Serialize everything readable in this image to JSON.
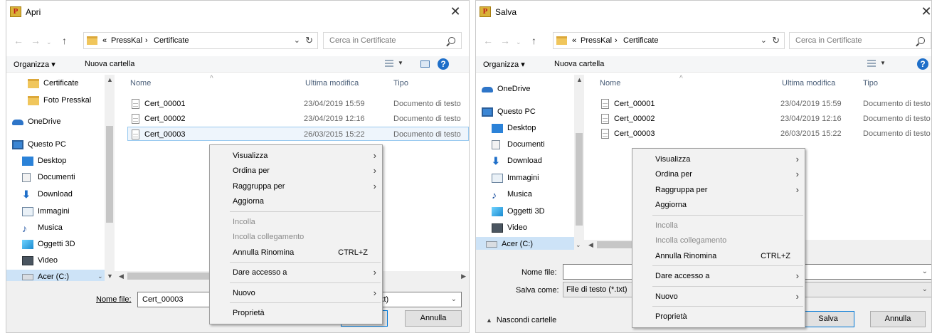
{
  "dialogs": [
    {
      "title": "Apri",
      "app_icon": "presskal-icon",
      "address": {
        "prefix": "«",
        "path": [
          "PressKal",
          "Certificate"
        ],
        "separator": "›"
      },
      "search_placeholder": "Cerca in Certificate",
      "toolbar": {
        "organize": "Organizza ▾",
        "new_folder": "Nuova cartella"
      },
      "nav_items": [
        {
          "label": "Certificate",
          "icon": "folder-icon"
        },
        {
          "label": "Foto Presskal",
          "icon": "folder-icon"
        },
        {
          "label": "OneDrive",
          "icon": "onedrive-icon"
        },
        {
          "label": "Questo PC",
          "icon": "computer-icon"
        },
        {
          "label": "Desktop",
          "icon": "desktop-icon"
        },
        {
          "label": "Documenti",
          "icon": "documents-icon"
        },
        {
          "label": "Download",
          "icon": "download-icon"
        },
        {
          "label": "Immagini",
          "icon": "images-icon"
        },
        {
          "label": "Musica",
          "icon": "music-icon"
        },
        {
          "label": "Oggetti 3D",
          "icon": "3d-objects-icon"
        },
        {
          "label": "Video",
          "icon": "video-icon"
        },
        {
          "label": "Acer (C:)",
          "icon": "drive-icon"
        }
      ],
      "columns": [
        "Nome",
        "Ultima modifica",
        "Tipo"
      ],
      "files": [
        {
          "name": "Cert_00001",
          "modified": "23/04/2019 15:59",
          "type": "Documento di testo"
        },
        {
          "name": "Cert_00002",
          "modified": "23/04/2019 12:16",
          "type": "Documento di testo"
        },
        {
          "name": "Cert_00003",
          "modified": "26/03/2015 15:22",
          "type": "Documento di testo"
        }
      ],
      "selected_file": "Cert_00003",
      "bottom": {
        "filename_label": "Nome file:",
        "filename_value": "Cert_00003",
        "filter_visible": "xt)",
        "cancel": "Annulla"
      }
    },
    {
      "title": "Salva",
      "app_icon": "presskal-icon",
      "address": {
        "prefix": "«",
        "path": [
          "PressKal",
          "Certificate"
        ],
        "separator": "›"
      },
      "search_placeholder": "Cerca in Certificate",
      "toolbar": {
        "organize": "Organizza ▾",
        "new_folder": "Nuova cartella"
      },
      "nav_items": [
        {
          "label": "OneDrive",
          "icon": "onedrive-icon"
        },
        {
          "label": "Questo PC",
          "icon": "computer-icon"
        },
        {
          "label": "Desktop",
          "icon": "desktop-icon"
        },
        {
          "label": "Documenti",
          "icon": "documents-icon"
        },
        {
          "label": "Download",
          "icon": "download-icon"
        },
        {
          "label": "Immagini",
          "icon": "images-icon"
        },
        {
          "label": "Musica",
          "icon": "music-icon"
        },
        {
          "label": "Oggetti 3D",
          "icon": "3d-objects-icon"
        },
        {
          "label": "Video",
          "icon": "video-icon"
        },
        {
          "label": "Acer (C:)",
          "icon": "drive-icon"
        }
      ],
      "columns": [
        "Nome",
        "Ultima modifica",
        "Tipo"
      ],
      "files": [
        {
          "name": "Cert_00001",
          "modified": "23/04/2019 15:59",
          "type": "Documento di testo"
        },
        {
          "name": "Cert_00002",
          "modified": "23/04/2019 12:16",
          "type": "Documento di testo"
        },
        {
          "name": "Cert_00003",
          "modified": "26/03/2015 15:22",
          "type": "Documento di testo"
        }
      ],
      "bottom": {
        "filename_label": "Nome file:",
        "filename_value": "",
        "savetype_label": "Salva come:",
        "savetype_value": "File di testo (*.txt)",
        "hide_folders": "Nascondi cartelle",
        "save": "Salva",
        "cancel": "Annulla"
      }
    }
  ],
  "context_menu": {
    "items": [
      {
        "label": "Visualizza",
        "submenu": true
      },
      {
        "label": "Ordina per",
        "submenu": true
      },
      {
        "label": "Raggruppa per",
        "submenu": true
      },
      {
        "label": "Aggiorna"
      },
      {
        "separator": true
      },
      {
        "label": "Incolla",
        "disabled": true
      },
      {
        "label": "Incolla collegamento",
        "disabled": true
      },
      {
        "label": "Annulla Rinomina",
        "shortcut": "CTRL+Z"
      },
      {
        "separator": true
      },
      {
        "label": "Dare accesso a",
        "submenu": true
      },
      {
        "separator": true
      },
      {
        "label": "Nuovo",
        "submenu": true
      },
      {
        "separator": true
      },
      {
        "label": "Proprietà"
      }
    ]
  }
}
